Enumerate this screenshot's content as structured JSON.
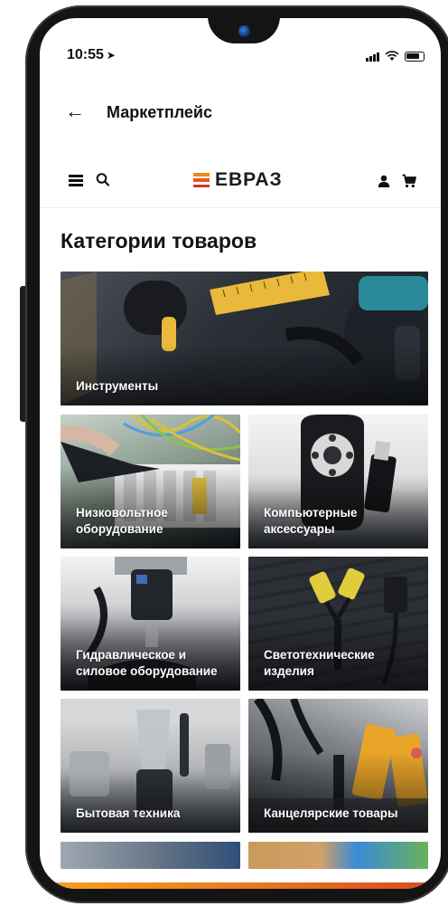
{
  "status_bar": {
    "time": "10:55",
    "location_icon": "location-arrow-icon",
    "icons": [
      "signal-icon",
      "wifi-icon",
      "battery-icon"
    ]
  },
  "header": {
    "back_icon": "arrow-left-icon",
    "title": "Маркетплейс"
  },
  "nav": {
    "menu_icon": "hamburger-menu-icon",
    "search_icon": "search-icon",
    "logo_text": "ЕВРАЗ",
    "user_icon": "user-icon",
    "cart_icon": "cart-icon"
  },
  "main": {
    "title": "Категории товаров",
    "categories": [
      {
        "label": "Инструменты",
        "icon": "tools-image"
      },
      {
        "label": "Низковольтное оборудование",
        "icon": "circuit-breaker-image"
      },
      {
        "label": "Компьютерные аксессуары",
        "icon": "presenter-remote-image"
      },
      {
        "label": "Гидравлическое и силовое оборудование",
        "icon": "hydraulic-press-image"
      },
      {
        "label": "Светотехнические изделия",
        "icon": "work-lights-image"
      },
      {
        "label": "Бытовая техника",
        "icon": "blender-image"
      },
      {
        "label": "Канцелярские товары",
        "icon": "stationery-image"
      }
    ]
  },
  "colors": {
    "brand_orange": "#f08a1c",
    "brand_red": "#d9301f",
    "text_dark": "#141414"
  }
}
